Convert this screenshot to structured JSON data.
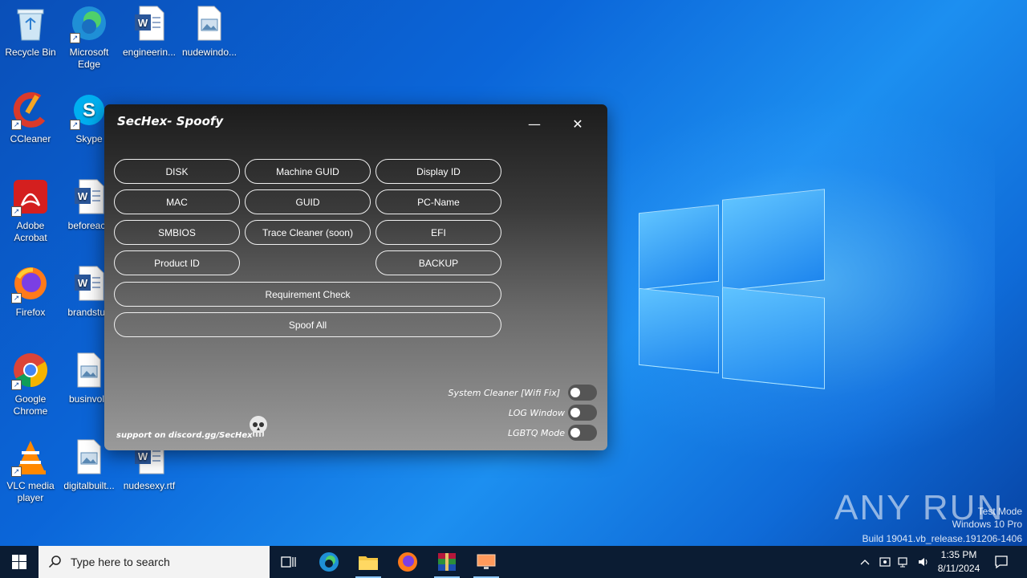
{
  "desktop": {
    "icons": [
      {
        "label": "Recycle Bin",
        "icon": "recycle-bin-icon"
      },
      {
        "label": "Microsoft Edge",
        "icon": "edge-icon"
      },
      {
        "label": "engineerin...",
        "icon": "word-doc-icon"
      },
      {
        "label": "nudewindo...",
        "icon": "image-file-icon"
      },
      {
        "label": "CCleaner",
        "icon": "ccleaner-icon"
      },
      {
        "label": "Skype",
        "icon": "skype-icon"
      },
      {
        "label": "Adobe Acrobat",
        "icon": "acrobat-icon"
      },
      {
        "label": "beforeacc",
        "icon": "word-doc-icon"
      },
      {
        "label": "Firefox",
        "icon": "firefox-icon"
      },
      {
        "label": "brandstud",
        "icon": "word-doc-icon"
      },
      {
        "label": "Google Chrome",
        "icon": "chrome-icon"
      },
      {
        "label": "businvolv",
        "icon": "image-file-icon"
      },
      {
        "label": "VLC media player",
        "icon": "vlc-icon"
      },
      {
        "label": "digitalbuilt...",
        "icon": "image-file-icon"
      },
      {
        "label": "nudesexy.rtf",
        "icon": "word-doc-icon"
      }
    ]
  },
  "app": {
    "title": "SecHex- Spoofy",
    "minimize": "—",
    "close": "✕",
    "buttons": {
      "disk": "DISK",
      "machine_guid": "Machine GUID",
      "display_id": "Display ID",
      "mac": "MAC",
      "guid": "GUID",
      "pc_name": "PC-Name",
      "smbios": "SMBIOS",
      "trace_cleaner": "Trace Cleaner (soon)",
      "efi": "EFI",
      "product_id": "Product ID",
      "backup": "BACKUP",
      "requirement_check": "Requirement Check",
      "spoof_all": "Spoof All"
    },
    "toggles": [
      {
        "label": "System Cleaner [Wifi Fix]",
        "on": false
      },
      {
        "label": "LOG Window",
        "on": false
      },
      {
        "label": "LGBTQ Mode",
        "on": false
      }
    ],
    "support": "support on discord.gg/SecHex"
  },
  "watermark": {
    "brand": "ANY RUN",
    "mode": "Test Mode",
    "os": "Windows 10 Pro",
    "build": "Build 19041.vb_release.191206-1406"
  },
  "taskbar": {
    "search_placeholder": "Type here to search",
    "time": "1:35 PM",
    "date": "8/11/2024",
    "colors": {
      "bar": "#0b1c33",
      "accent": "#8ec8ff"
    }
  }
}
